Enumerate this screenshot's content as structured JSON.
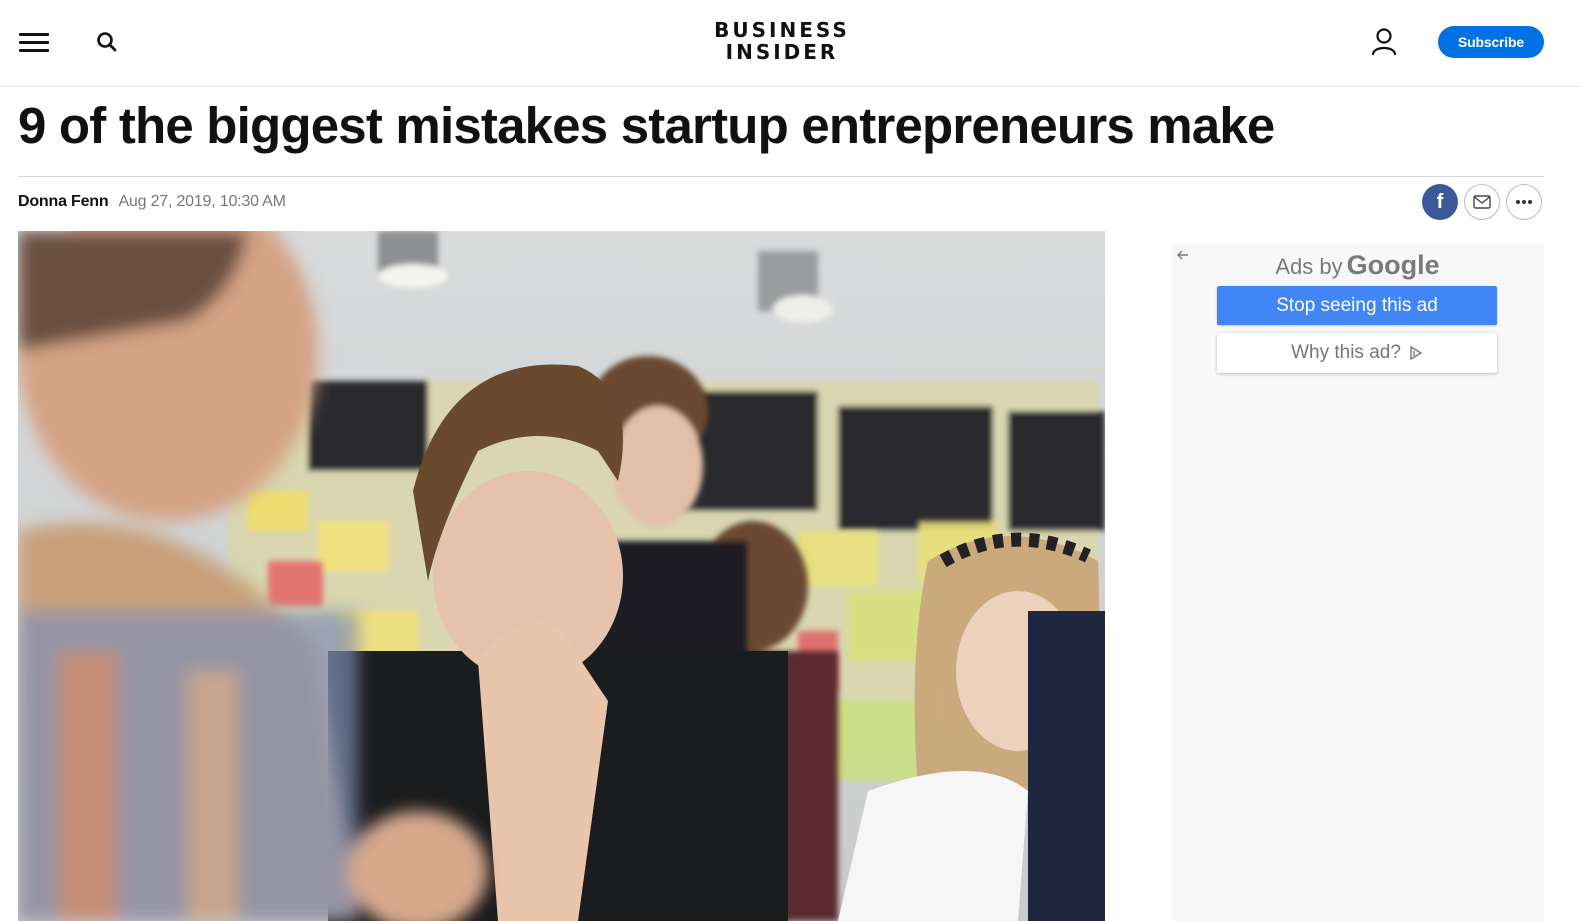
{
  "header": {
    "logo_line1": "BUSINESS",
    "logo_line2": "INSIDER",
    "subscribe_label": "Subscribe",
    "icons": [
      "menu-icon",
      "search-icon",
      "account-icon"
    ]
  },
  "article": {
    "headline": "9 of the biggest mistakes startup entrepreneurs make",
    "author": "Donna Fenn",
    "date": "Aug 27, 2019, 10:30 AM"
  },
  "share": {
    "facebook_letter": "f",
    "icons": [
      "facebook-icon",
      "email-icon",
      "more-icon"
    ]
  },
  "ad": {
    "ads_by_text": "Ads by",
    "ads_by_brand": "Google",
    "stop_label": "Stop seeing this ad",
    "why_label": "Why this ad?",
    "icons": [
      "back-arrow-icon",
      "adchoices-icon"
    ]
  },
  "colors": {
    "subscribe_blue": "#0071e3",
    "facebook_blue": "#3b5998",
    "google_ad_blue": "#4285f4"
  }
}
